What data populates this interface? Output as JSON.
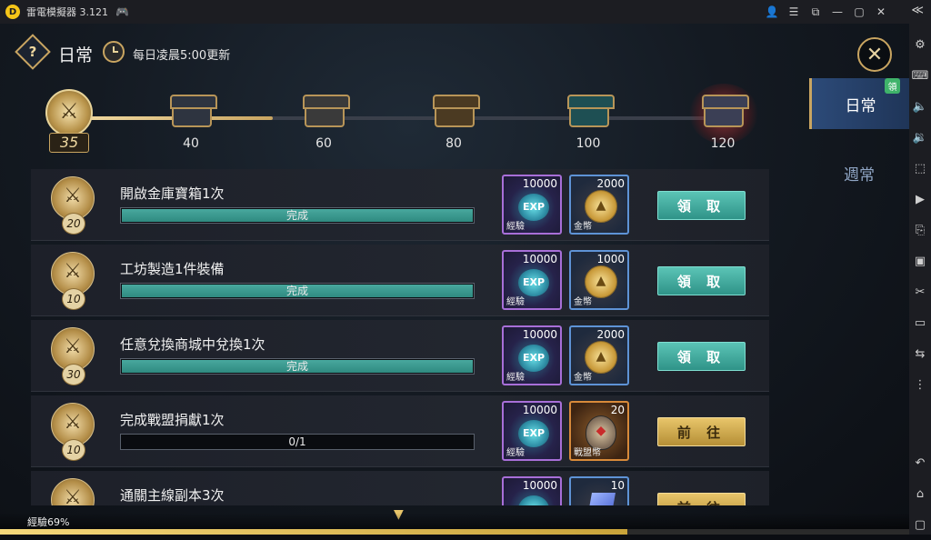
{
  "window": {
    "title": "雷電模擬器 3.121",
    "logo_char": "D",
    "gamepad_icon": "🎮",
    "controls": [
      "👤",
      "☰",
      "⧉",
      "—",
      "▢",
      "✕"
    ],
    "collapse_icon": "≪"
  },
  "sidebar": {
    "icons": [
      "⚙",
      "⌨",
      "🔈",
      "🔉",
      "⬚",
      "▶",
      "⎘",
      "▣",
      "✂",
      "▭",
      "⇆",
      "⋮",
      "↶",
      "⌂",
      "▢"
    ]
  },
  "header": {
    "help_glyph": "?",
    "title": "日常",
    "reset_text": "每日凌晨5:00更新",
    "close_glyph": "✕"
  },
  "tabs": [
    {
      "label": "日常",
      "active": true,
      "badge": "領"
    },
    {
      "label": "週常",
      "active": false
    }
  ],
  "progress": {
    "current": 35,
    "max": 120,
    "milestones": [
      {
        "value": "40",
        "color": "#2e3440",
        "glow": false
      },
      {
        "value": "60",
        "color": "#3a3a3a",
        "glow": false
      },
      {
        "value": "80",
        "color": "#4b3a22",
        "glow": false
      },
      {
        "value": "100",
        "color": "#1e4f53",
        "glow": false
      },
      {
        "value": "120",
        "color": "#3b3f55",
        "glow": true
      }
    ]
  },
  "tasks": [
    {
      "name": "開啟金庫寶箱1次",
      "medal": "20",
      "progress_text": "完成",
      "progress": 1.0,
      "exp_amount": "10000",
      "exp_label": "經驗",
      "exp_icon": "EXP",
      "reward2_amount": "2000",
      "reward2_label": "金幣",
      "reward2_type": "gold",
      "action": "領 取",
      "action_type": "claim"
    },
    {
      "name": "工坊製造1件裝備",
      "medal": "10",
      "progress_text": "完成",
      "progress": 1.0,
      "exp_amount": "10000",
      "exp_label": "經驗",
      "exp_icon": "EXP",
      "reward2_amount": "1000",
      "reward2_label": "金幣",
      "reward2_type": "gold",
      "action": "領 取",
      "action_type": "claim"
    },
    {
      "name": "任意兌換商城中兌換1次",
      "medal": "30",
      "progress_text": "完成",
      "progress": 1.0,
      "exp_amount": "10000",
      "exp_label": "經驗",
      "exp_icon": "EXP",
      "reward2_amount": "2000",
      "reward2_label": "金幣",
      "reward2_type": "gold",
      "action": "領 取",
      "action_type": "claim"
    },
    {
      "name": "完成戰盟捐獻1次",
      "medal": "10",
      "progress_text": "0/1",
      "progress": 0,
      "exp_amount": "10000",
      "exp_label": "經驗",
      "exp_icon": "EXP",
      "reward2_amount": "20",
      "reward2_label": "戰盟幣",
      "reward2_type": "ally",
      "action": "前 往",
      "action_type": "go"
    },
    {
      "name": "通關主線副本3次",
      "medal": "",
      "progress_text": "",
      "progress": 0,
      "exp_amount": "10000",
      "exp_label": "",
      "exp_icon": "",
      "reward2_amount": "10",
      "reward2_label": "",
      "reward2_type": "crystal",
      "action": "前 往",
      "action_type": "go"
    }
  ],
  "footer": {
    "scroll_glyph": "▼",
    "exp_label": "經驗69%",
    "exp_percent": 69
  }
}
